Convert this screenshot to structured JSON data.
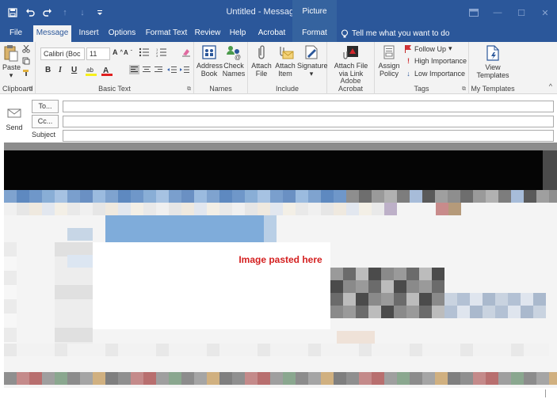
{
  "window": {
    "title": "Untitled - Message (HTML)",
    "contextual_group": "Picture Tools"
  },
  "quick_access": [
    "save-icon",
    "undo-icon",
    "redo-icon",
    "up-arrow-icon",
    "down-arrow-icon",
    "customize-icon"
  ],
  "tabs": [
    {
      "label": "File"
    },
    {
      "label": "Message"
    },
    {
      "label": "Insert"
    },
    {
      "label": "Options"
    },
    {
      "label": "Format Text"
    },
    {
      "label": "Review"
    },
    {
      "label": "Help"
    },
    {
      "label": "Acrobat"
    },
    {
      "label": "Format"
    }
  ],
  "tell_me": "Tell me what you want to do",
  "ribbon": {
    "clipboard": {
      "paste": "Paste",
      "label": "Clipboard"
    },
    "basic_text": {
      "font": "Calibri (Boc",
      "size": "11",
      "bold": "B",
      "italic": "I",
      "underline": "U",
      "label": "Basic Text"
    },
    "names": {
      "address_book_1": "Address",
      "address_book_2": "Book",
      "check_names_1": "Check",
      "check_names_2": "Names",
      "label": "Names"
    },
    "include": {
      "attach_file_1": "Attach",
      "attach_file_2": "File",
      "attach_item_1": "Attach",
      "attach_item_2": "Item",
      "signature": "Signature",
      "label": "Include"
    },
    "acrobat": {
      "attach_link_1": "Attach File",
      "attach_link_2": "via Link",
      "label": "Adobe Acrobat"
    },
    "tags": {
      "assign_1": "Assign",
      "assign_2": "Policy",
      "follow_up": "Follow Up",
      "high": "High Importance",
      "low": "Low Importance",
      "label": "Tags"
    },
    "templates": {
      "view_1": "View",
      "view_2": "Templates",
      "label": "My Templates"
    }
  },
  "compose": {
    "send": "Send",
    "to": "To...",
    "cc": "Cc...",
    "subject": "Subject",
    "to_value": "",
    "cc_value": "",
    "subject_value": ""
  },
  "body": {
    "pasted_label": "Image pasted here"
  }
}
